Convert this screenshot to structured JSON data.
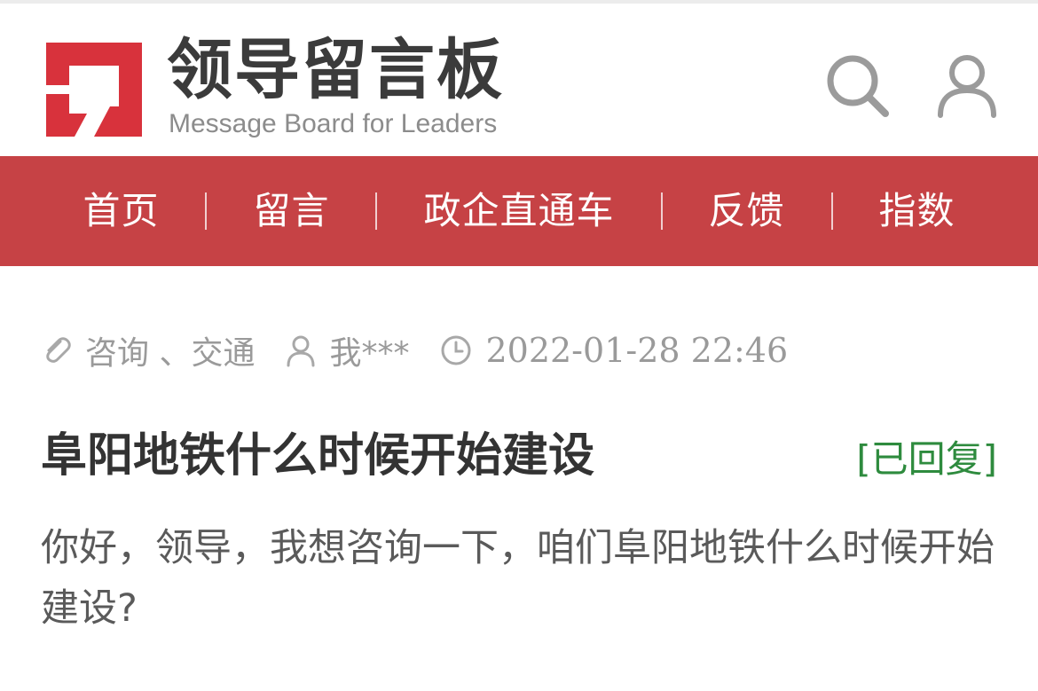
{
  "header": {
    "logo_title": "领导留言板",
    "logo_subtitle": "Message Board for Leaders",
    "search_icon": "search-icon",
    "user_icon": "user-icon"
  },
  "nav": {
    "items": [
      "首页",
      "留言",
      "政企直通车",
      "反馈",
      "指数"
    ]
  },
  "post": {
    "category": "咨询 、交通",
    "author": "我***",
    "timestamp": "2022-01-28 22:46",
    "title": "阜阳地铁什么时候开始建设",
    "status": "[已回复]",
    "body": "你好，领导，我想咨询一下，咱们阜阳地铁什么时候开始建设?"
  },
  "colors": {
    "brand_red": "#c64245",
    "logo_red": "#d8323c",
    "status_green": "#2e8b3e"
  }
}
